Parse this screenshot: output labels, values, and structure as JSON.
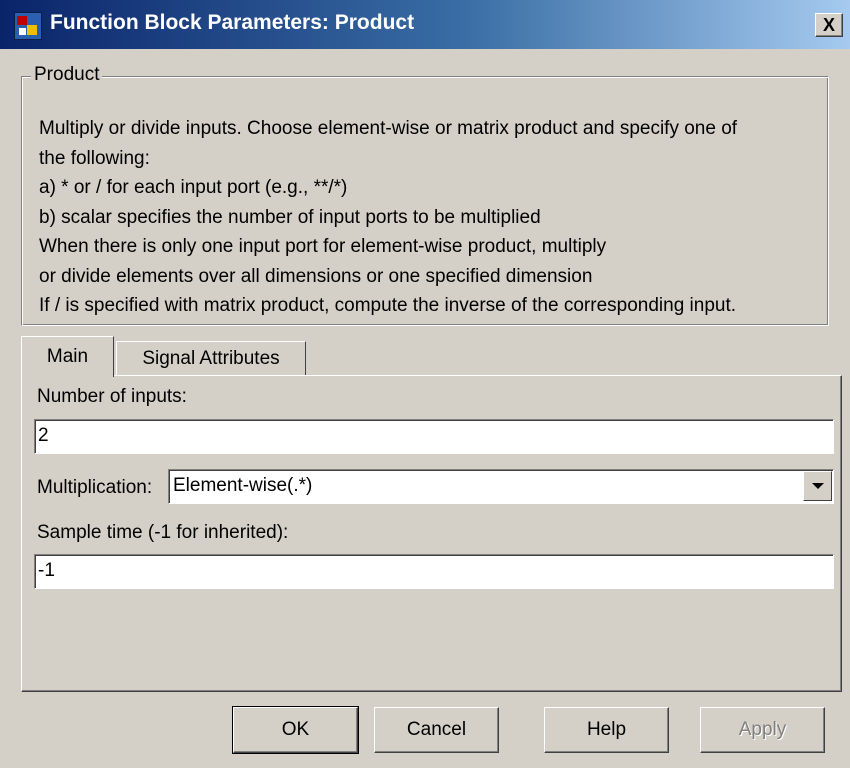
{
  "window": {
    "title": "Function Block Parameters: Product",
    "close_glyph": "X",
    "icon": "simulink-block-icon"
  },
  "group": {
    "legend": "Product",
    "description": [
      "Multiply or divide inputs.  Choose element-wise or matrix product and specify one of",
      "the following:",
      "a) * or / for each input port (e.g., **/*)",
      "b) scalar specifies the number of input ports to be multiplied",
      "When there is only one input port for element-wise product, multiply",
      "or divide elements over all dimensions or one specified dimension",
      "If / is specified with matrix product, compute the inverse of the corresponding input."
    ]
  },
  "tabs": [
    {
      "label": "Main",
      "selected": true
    },
    {
      "label": "Signal Attributes",
      "selected": false
    }
  ],
  "fields": {
    "num_inputs_label": "Number of inputs:",
    "num_inputs_value": "2",
    "multiplication_label": "Multiplication:",
    "multiplication_value": "Element-wise(.*)",
    "sample_time_label": "Sample time (-1 for inherited):",
    "sample_time_value": "-1"
  },
  "buttons": {
    "ok": "OK",
    "cancel": "Cancel",
    "help": "Help",
    "apply": "Apply"
  },
  "colors": {
    "face": "#d4d0c8",
    "title_start": "#0a246a",
    "title_end": "#a6caf0",
    "disabled_text": "#808080"
  }
}
